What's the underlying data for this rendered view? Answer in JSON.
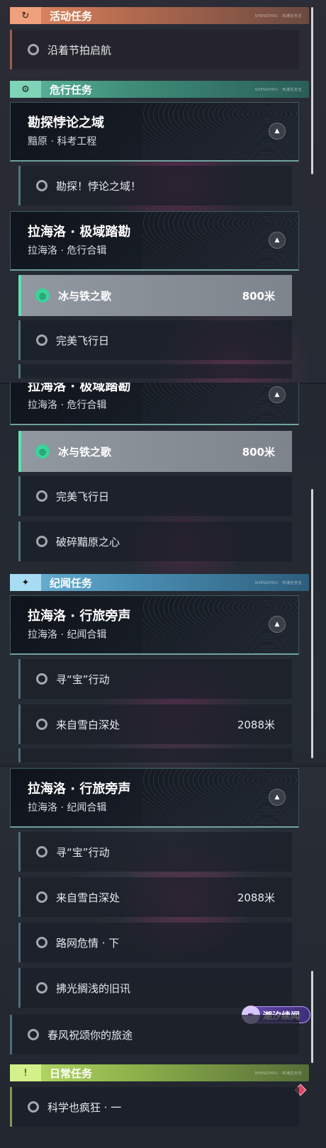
{
  "segment1": {
    "activity_header": {
      "label": "活动任务",
      "icon": "refresh-icon",
      "tag": "SHENZHOU · 鸣潮任务志"
    },
    "activity_rows": [
      {
        "title": "沿着节拍启航"
      }
    ],
    "danger_header": {
      "label": "危行任务",
      "icon": "gear-target-icon",
      "tag": "SHENZHOU · 鸣潮任务志"
    },
    "group1": {
      "title": "勘探悖论之域",
      "subtitle": "黯原 · 科考工程",
      "toggle": "▲"
    },
    "group1_rows": [
      {
        "title": "勘探！悖论之域！"
      }
    ],
    "group2": {
      "title": "拉海洛 · 极域踏勘",
      "subtitle": "拉海洛 · 危行合辑",
      "toggle": "▲"
    },
    "group2_rows": [
      {
        "title": "冰与铁之歌",
        "distance": "800米"
      },
      {
        "title": "完美飞行日"
      }
    ]
  },
  "segment2": {
    "group2": {
      "title": "拉海洛 · 极域踏勘",
      "subtitle": "拉海洛 · 危行合辑",
      "toggle": "▲"
    },
    "group2_rows": [
      {
        "title": "冰与铁之歌",
        "distance": "800米"
      },
      {
        "title": "完美飞行日"
      },
      {
        "title": "破碎黯原之心"
      }
    ],
    "chronicle_header": {
      "label": "纪闻任务",
      "icon": "sparkle-icon",
      "tag": "SHENZHOU · 鸣潮任务志"
    },
    "group3": {
      "title": "拉海洛 · 行旅旁声",
      "subtitle": "拉海洛 · 纪闻合辑",
      "toggle": "▲"
    },
    "group3_rows": [
      {
        "title": "寻“宝”行动"
      },
      {
        "title": "来自雪白深处",
        "distance": "2088米"
      }
    ]
  },
  "segment3": {
    "group3": {
      "title": "拉海洛 · 行旅旁声",
      "subtitle": "拉海洛 · 纪闻合辑",
      "toggle": "▲"
    },
    "group3_rows": [
      {
        "title": "寻“宝”行动"
      },
      {
        "title": "来自雪白深处",
        "distance": "2088米"
      },
      {
        "title": "路网危情 · 下"
      },
      {
        "title": "拂光搁浅的旧讯"
      }
    ],
    "extra_row": {
      "title": "春风祝颂你的旅途"
    },
    "badge": {
      "label": "潮汐续闻",
      "icon": "feather-icon"
    },
    "daily_header": {
      "label": "日常任务",
      "icon": "alert-icon",
      "tag": "SHENZHOU · 鸣潮任务志"
    },
    "daily_rows": [
      {
        "title": "科学也疯狂 · 一"
      }
    ]
  },
  "colors": {
    "activity": "#e58a63",
    "danger": "#5fb89d",
    "chronicle": "#6fb5d8",
    "daily": "#b9df6a",
    "selected_marker": "#3bd39a"
  }
}
